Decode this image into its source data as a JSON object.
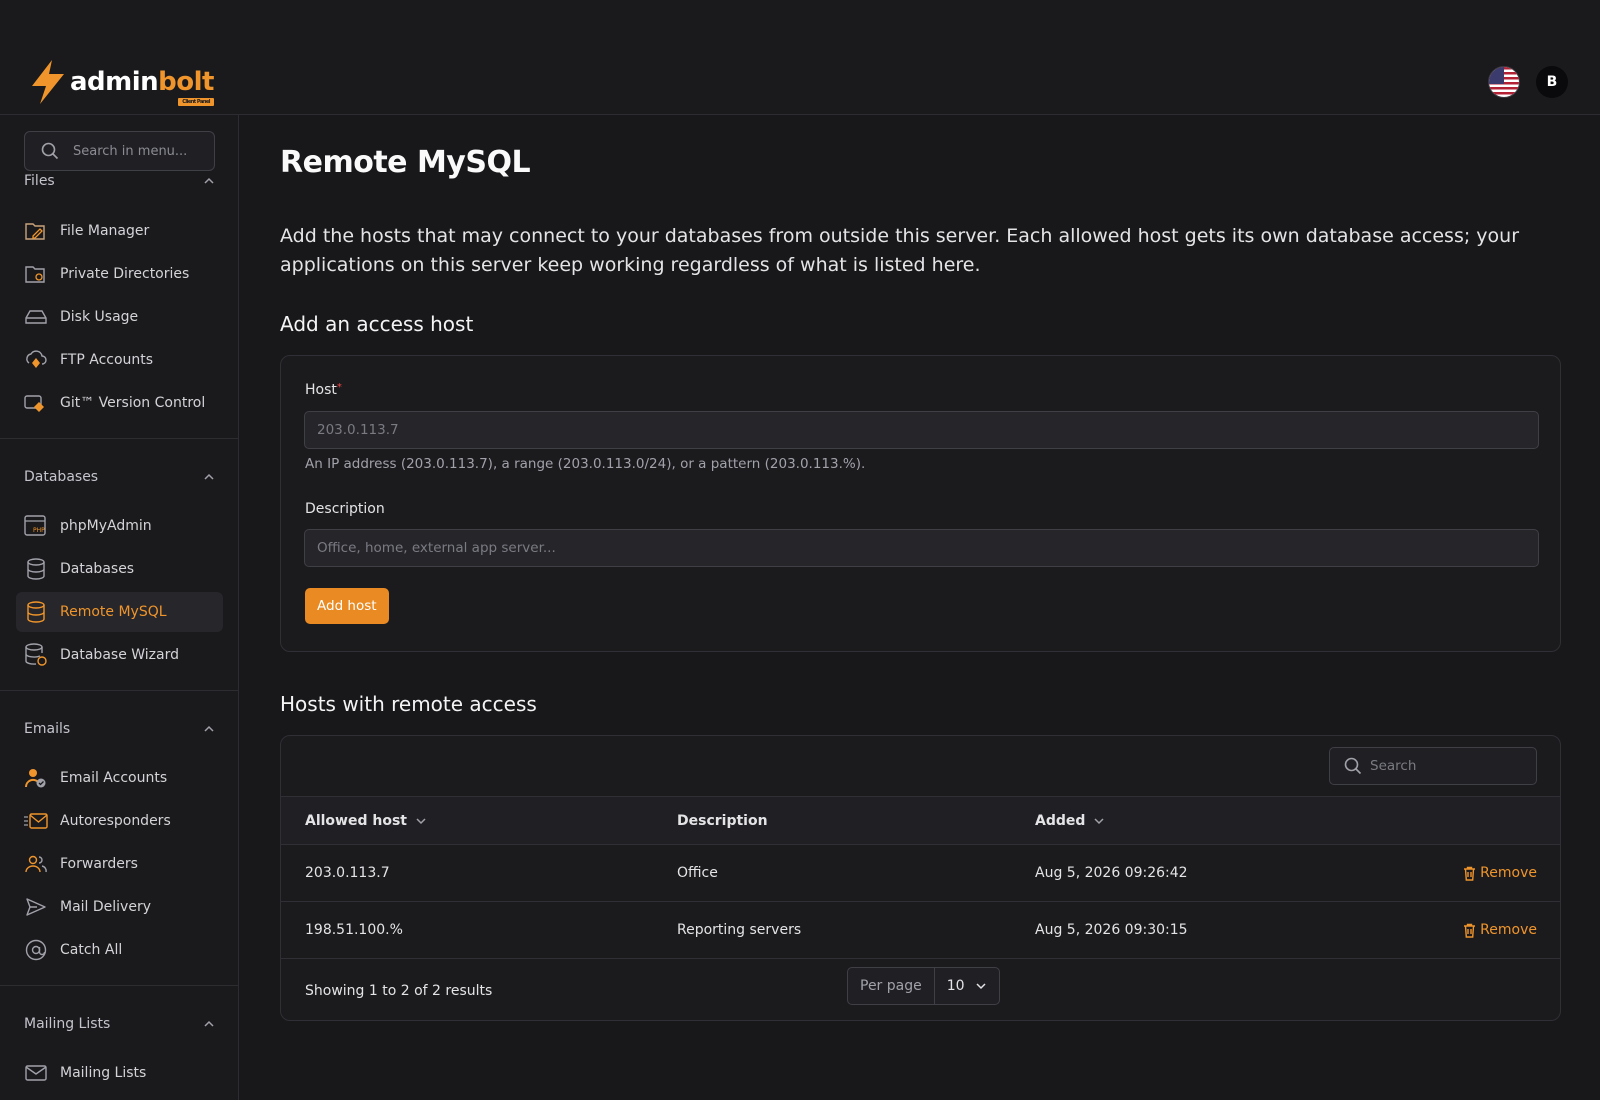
{
  "brand": {
    "name_a": "admin",
    "name_b": "bolt",
    "badge": "Client Panel"
  },
  "header": {
    "avatar_letter": "B"
  },
  "sidebar": {
    "search_placeholder": "Search in menu...",
    "files_heading": "Files",
    "files": [
      {
        "label": "File Manager",
        "icon": "folder-edit-icon"
      },
      {
        "label": "Private Directories",
        "icon": "folder-lock-icon"
      },
      {
        "label": "Disk Usage",
        "icon": "hard-drive-icon"
      },
      {
        "label": "FTP Accounts",
        "icon": "ftp-cloud-icon"
      },
      {
        "label": "Git™ Version Control",
        "icon": "git-icon"
      }
    ],
    "databases_heading": "Databases",
    "databases": [
      {
        "label": "phpMyAdmin",
        "icon": "php-icon"
      },
      {
        "label": "Databases",
        "icon": "database-icon"
      },
      {
        "label": "Remote MySQL",
        "icon": "database-icon"
      },
      {
        "label": "Database Wizard",
        "icon": "database-wizard-icon"
      }
    ],
    "emails_heading": "Emails",
    "emails": [
      {
        "label": "Email Accounts",
        "icon": "user-check-icon"
      },
      {
        "label": "Autoresponders",
        "icon": "auto-mail-icon"
      },
      {
        "label": "Forwarders",
        "icon": "users-icon"
      },
      {
        "label": "Mail Delivery",
        "icon": "send-icon"
      },
      {
        "label": "Catch All",
        "icon": "at-icon"
      }
    ],
    "mailing_heading": "Mailing Lists",
    "mailing": [
      {
        "label": "Mailing Lists",
        "icon": "mail-icon"
      }
    ]
  },
  "page": {
    "title": "Remote MySQL",
    "intro": "Add the hosts that may connect to your databases from outside this server. Each allowed host gets its own database access; your applications on this server keep working regardless of what is listed here.",
    "add_heading": "Add an access host",
    "host_label": "Host",
    "host_required": "*",
    "host_placeholder": "203.0.113.7",
    "host_help": "An IP address (203.0.113.7), a range (203.0.113.0/24), or a pattern (203.0.113.%).",
    "desc_label": "Description",
    "desc_placeholder": "Office, home, external app server...",
    "add_button": "Add host",
    "list_heading": "Hosts with remote access"
  },
  "table": {
    "search_placeholder": "Search",
    "columns": [
      "Allowed host",
      "Description",
      "Added"
    ],
    "rows": [
      {
        "host": "203.0.113.7",
        "description": "Office",
        "added": "Aug 5, 2026 09:26:42",
        "action": "Remove"
      },
      {
        "host": "198.51.100.%",
        "description": "Reporting servers",
        "added": "Aug 5, 2026 09:30:15",
        "action": "Remove"
      }
    ],
    "summary": "Showing 1 to 2 of 2 results",
    "per_page_label": "Per page",
    "per_page_value": "10"
  },
  "colors": {
    "accent": "#f0952b",
    "background": "#18181b"
  }
}
